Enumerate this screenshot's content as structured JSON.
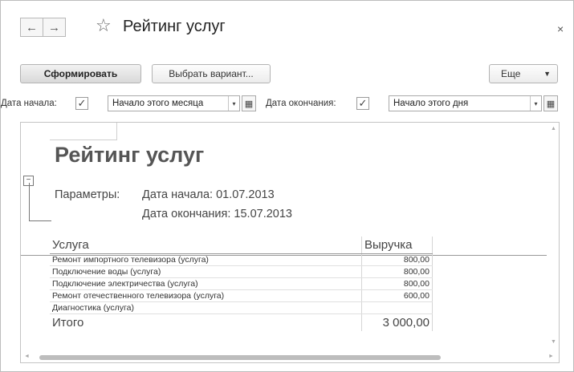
{
  "window": {
    "title": "Рейтинг услуг",
    "back_icon": "←",
    "forward_icon": "→",
    "star_icon": "☆",
    "close_icon": "×"
  },
  "toolbar": {
    "generate_label": "Сформировать",
    "variant_label": "Выбрать вариант...",
    "more_label": "Еще",
    "more_arrow": "▼"
  },
  "params": {
    "start_label": "Дата начала:",
    "start_checked": "✓",
    "start_value": "Начало этого месяца",
    "end_label": "Дата окончания:",
    "end_checked": "✓",
    "end_value": "Начало этого дня",
    "dropdown_icon": "▾",
    "calendar_icon": "▦"
  },
  "report": {
    "title": "Рейтинг услуг",
    "params_label": "Параметры:",
    "param_start": "Дата начала: 01.07.2013",
    "param_end": "Дата окончания: 15.07.2013",
    "group_toggle": "−",
    "columns": [
      "Услуга",
      "Выручка"
    ],
    "rows": [
      {
        "service": "Ремонт импортного телевизора (услуга)",
        "revenue": "800,00"
      },
      {
        "service": "Подключение воды (услуга)",
        "revenue": "800,00"
      },
      {
        "service": "Подключение электричества (услуга)",
        "revenue": "800,00"
      },
      {
        "service": "Ремонт отечественного телевизора (услуга)",
        "revenue": "600,00"
      },
      {
        "service": "Диагностика (услуга)",
        "revenue": ""
      }
    ],
    "total_label": "Итого",
    "total_value": "3 000,00"
  },
  "scroll": {
    "up": "▲",
    "down": "▼",
    "left": "◄",
    "right": "►"
  }
}
